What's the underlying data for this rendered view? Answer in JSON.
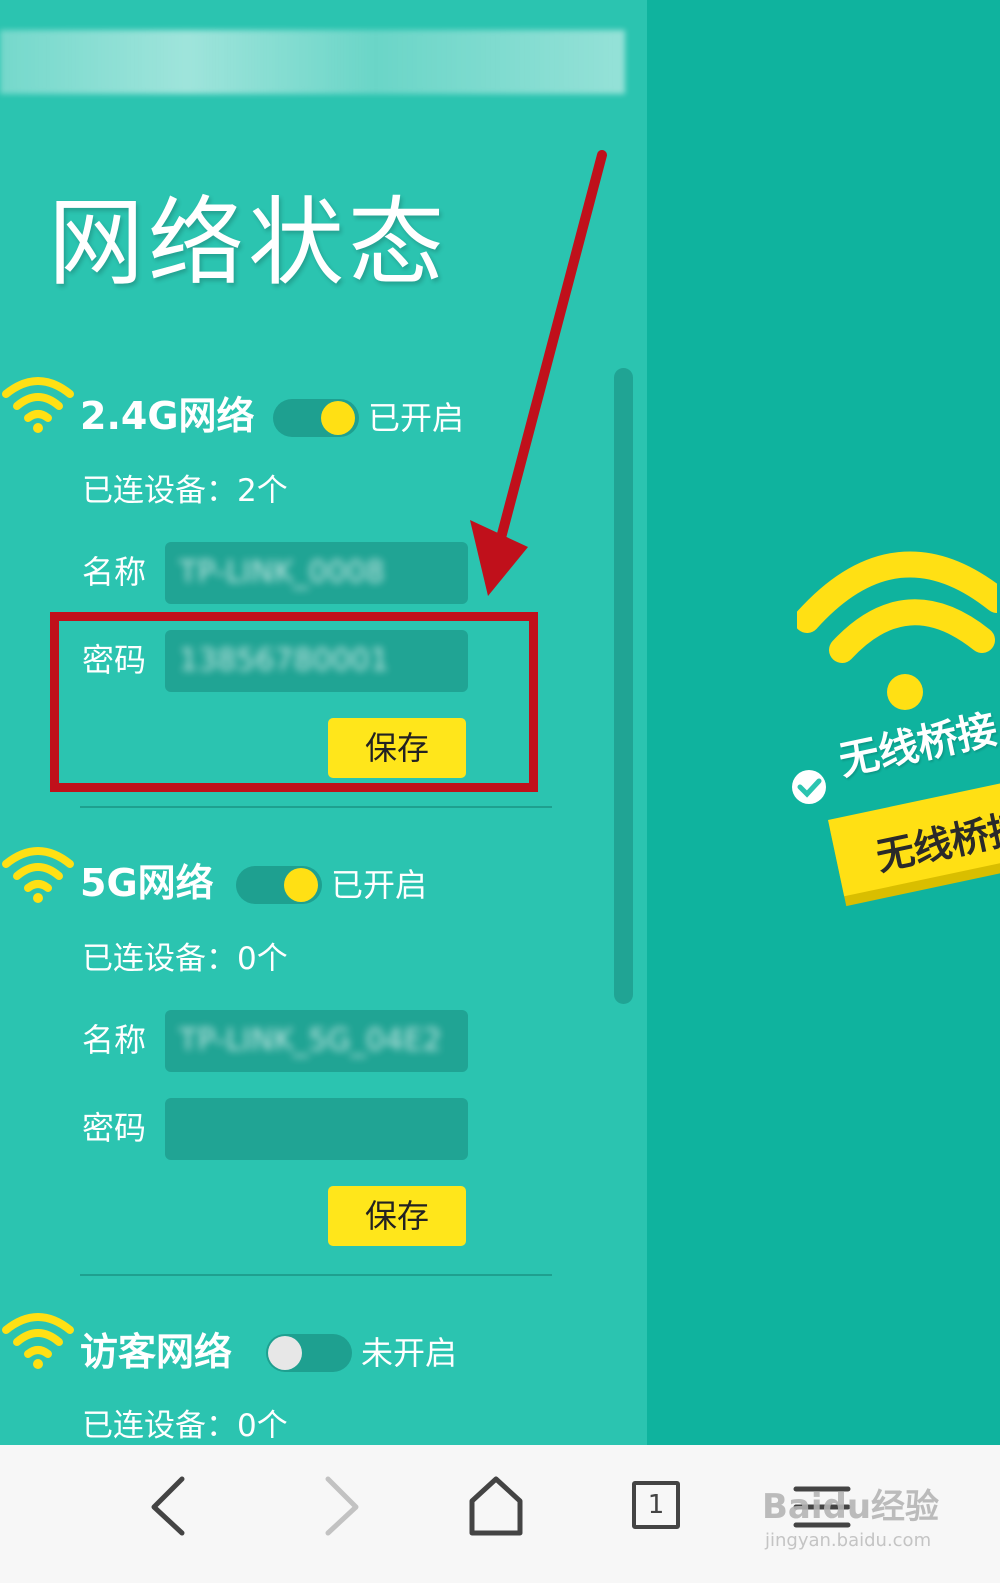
{
  "page": {
    "title": "网络状态"
  },
  "networks": [
    {
      "title": "2.4G网络",
      "toggle_status": "已开启",
      "enabled": true,
      "connected_devices": "已连设备：2个",
      "name_label": "名称",
      "name_value": "TP-LINK_0008",
      "password_label": "密码",
      "password_value": "13856780001",
      "save_label": "保存"
    },
    {
      "title": "5G网络",
      "toggle_status": "已开启",
      "enabled": true,
      "connected_devices": "已连设备：0个",
      "name_label": "名称",
      "name_value": "TP-LINK_5G_04E2",
      "password_label": "密码",
      "password_value": "",
      "save_label": "保存"
    },
    {
      "title": "访客网络",
      "toggle_status": "未开启",
      "enabled": false,
      "connected_devices": "已连设备：0个"
    }
  ],
  "promo": {
    "label": "无线桥接",
    "button": "无线桥接"
  },
  "bottom_nav": {
    "tab_count": "1",
    "items": [
      "back-icon",
      "forward-icon",
      "home-icon",
      "tabs-icon",
      "menu-icon"
    ]
  },
  "watermark": {
    "brand": "Baidu经验",
    "url": "jingyan.baidu.com"
  },
  "colors": {
    "panel_bg": "#2bc4b0",
    "right_bg": "#0fb39e",
    "accent_yellow": "#ffe014",
    "highlight_red": "#c0101b"
  }
}
